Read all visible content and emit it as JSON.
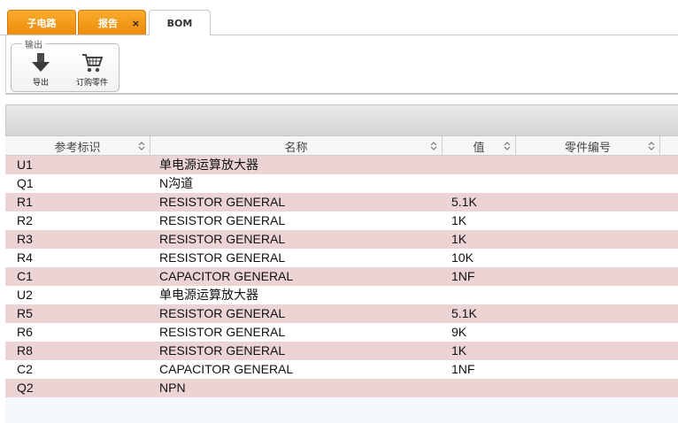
{
  "tabs": [
    {
      "label": "子电路"
    },
    {
      "label": "报告",
      "close": "×"
    },
    {
      "label": "BOM"
    }
  ],
  "ribbon": {
    "group_title": "输出",
    "export_label": "导出",
    "order_label": "订购零件"
  },
  "grid": {
    "columns": [
      {
        "label": "参考标识"
      },
      {
        "label": "名称"
      },
      {
        "label": "值"
      },
      {
        "label": "零件编号"
      }
    ],
    "rows": [
      {
        "ref": "U1",
        "name": "单电源运算放大器",
        "value": "",
        "part": ""
      },
      {
        "ref": "Q1",
        "name": "N沟道",
        "value": "",
        "part": ""
      },
      {
        "ref": "R1",
        "name": "RESISTOR GENERAL",
        "value": "5.1K",
        "part": ""
      },
      {
        "ref": "R2",
        "name": "RESISTOR GENERAL",
        "value": "1K",
        "part": ""
      },
      {
        "ref": "R3",
        "name": "RESISTOR GENERAL",
        "value": "1K",
        "part": ""
      },
      {
        "ref": "R4",
        "name": "RESISTOR GENERAL",
        "value": "10K",
        "part": ""
      },
      {
        "ref": "C1",
        "name": "CAPACITOR GENERAL",
        "value": "1NF",
        "part": ""
      },
      {
        "ref": "U2",
        "name": "单电源运算放大器",
        "value": "",
        "part": ""
      },
      {
        "ref": "R5",
        "name": "RESISTOR GENERAL",
        "value": "5.1K",
        "part": ""
      },
      {
        "ref": "R6",
        "name": "RESISTOR GENERAL",
        "value": "9K",
        "part": ""
      },
      {
        "ref": "R8",
        "name": "RESISTOR GENERAL",
        "value": "1K",
        "part": ""
      },
      {
        "ref": "C2",
        "name": "CAPACITOR GENERAL",
        "value": "1NF",
        "part": ""
      },
      {
        "ref": "Q2",
        "name": "NPN",
        "value": "",
        "part": ""
      }
    ]
  }
}
